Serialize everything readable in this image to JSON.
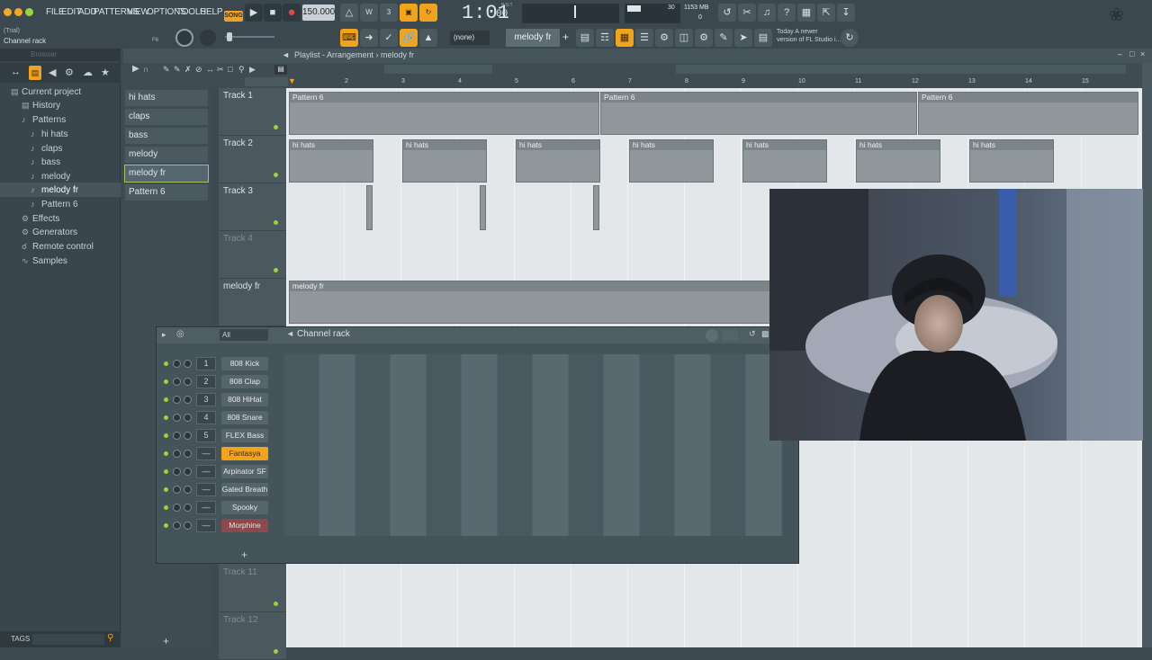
{
  "menu": [
    "FILE",
    "EDIT",
    "ADD",
    "PATTERNS",
    "VIEW",
    "OPTIONS",
    "TOOLS",
    "HELP"
  ],
  "transport": {
    "mode": "SONG",
    "tempo": "150.000",
    "time_main": "1:01",
    "time_sub": "00",
    "time_label": "B:S:T"
  },
  "stats": {
    "cpu": "30",
    "memory": "1153 MB",
    "polyphony": "0"
  },
  "hint": {
    "line1": "(Trial)",
    "line2": "Channel rack",
    "shortcut": "F6"
  },
  "pattern_selector": {
    "none_label": "(none)",
    "current": "melody fr"
  },
  "news": {
    "line1": "Today  A newer",
    "line2": "version of FL Studio i..."
  },
  "browser": {
    "title": "Browser",
    "items": [
      {
        "label": "Current project",
        "icon": "folder-icon"
      },
      {
        "label": "History",
        "icon": "history-icon"
      },
      {
        "label": "Patterns",
        "icon": "note-icon"
      },
      {
        "label": "hi hats",
        "icon": "note-icon"
      },
      {
        "label": "claps",
        "icon": "note-icon"
      },
      {
        "label": "bass",
        "icon": "note-icon"
      },
      {
        "label": "melody",
        "icon": "note-icon"
      },
      {
        "label": "melody fr",
        "icon": "note-icon"
      },
      {
        "label": "Pattern 6",
        "icon": "note-icon"
      },
      {
        "label": "Effects",
        "icon": "plug-icon"
      },
      {
        "label": "Generators",
        "icon": "plug-icon"
      },
      {
        "label": "Remote control",
        "icon": "remote-icon"
      },
      {
        "label": "Samples",
        "icon": "waveform-icon"
      }
    ],
    "tags_label": "TAGS"
  },
  "playlist": {
    "breadcrumb": "Playlist - Arrangement › melody fr",
    "patterns": [
      "hi hats",
      "claps",
      "bass",
      "melody",
      "melody fr",
      "Pattern 6"
    ],
    "ruler": [
      "2",
      "3",
      "4",
      "5",
      "6",
      "7",
      "8",
      "9",
      "10",
      "11",
      "12",
      "13",
      "14",
      "15"
    ],
    "tracks": [
      "Track 1",
      "Track 2",
      "Track 3",
      "Track 4",
      "melody fr",
      "Track 11",
      "Track 12"
    ],
    "clips": {
      "track1": [
        "Pattern 6",
        "Pattern 6",
        "Pattern 6"
      ],
      "track2": [
        "hi hats",
        "hi hats",
        "hi hats",
        "hi hats",
        "hi hats",
        "hi hats",
        "hi hats"
      ],
      "melody": "melody fr"
    }
  },
  "channel_rack": {
    "title": "Channel rack",
    "filter": "All",
    "channels": [
      {
        "num": "1",
        "name": "808 Kick",
        "color": "#56646c"
      },
      {
        "num": "2",
        "name": "808 Clap",
        "color": "#56646c"
      },
      {
        "num": "3",
        "name": "808 HiHat",
        "color": "#56646c"
      },
      {
        "num": "4",
        "name": "808 Snare",
        "color": "#56646c"
      },
      {
        "num": "5",
        "name": "FLEX Bass",
        "color": "#56646c"
      },
      {
        "num": "—",
        "name": "Fantasya",
        "color": "#f2a31c"
      },
      {
        "num": "—",
        "name": "Arpinator SF",
        "color": "#56646c"
      },
      {
        "num": "—",
        "name": "Gated Breath",
        "color": "#56646c"
      },
      {
        "num": "—",
        "name": "Spooky",
        "color": "#56646c"
      },
      {
        "num": "—",
        "name": "Morphine",
        "color": "#8a4a4e"
      }
    ],
    "add_label": "+"
  },
  "colors": {
    "accent": "#f2a31c",
    "led": "#9ad43a",
    "panel": "#3b4850"
  }
}
